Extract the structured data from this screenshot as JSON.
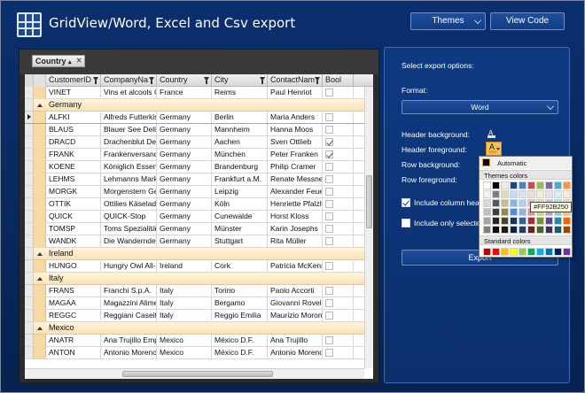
{
  "app": {
    "title": "GridView/Word, Excel and Csv export",
    "themes_label": "Themes",
    "view_code_label": "View Code"
  },
  "grid": {
    "group_chip": "Country",
    "columns": [
      "CustomerID",
      "CompanyNa",
      "Country",
      "City",
      "ContactNam",
      "Bool"
    ],
    "rows": [
      {
        "type": "data",
        "cells": [
          "VINET",
          "Vins et alcools C",
          "France",
          "Reims",
          "Paul Henriot",
          ""
        ],
        "bool": false
      },
      {
        "type": "group",
        "label": "Germany"
      },
      {
        "type": "data",
        "cells": [
          "ALFKI",
          "Alfreds Futterkis",
          "Germany",
          "Berlin",
          "Maria Anders",
          ""
        ],
        "bool": false,
        "selected": true
      },
      {
        "type": "data",
        "cells": [
          "BLAUS",
          "Blauer See Delik",
          "Germany",
          "Mannheim",
          "Hanna Moos",
          ""
        ],
        "bool": false
      },
      {
        "type": "data",
        "cells": [
          "DRACD",
          "Drachenblut Del",
          "Germany",
          "Aachen",
          "Sven Ottlieb",
          ""
        ],
        "bool": true
      },
      {
        "type": "data",
        "cells": [
          "FRANK",
          "Frankenversand",
          "Germany",
          "München",
          "Peter Franken",
          ""
        ],
        "bool": true
      },
      {
        "type": "data",
        "cells": [
          "KOENE",
          "Königlich Essen",
          "Germany",
          "Brandenburg",
          "Philip Cramer",
          ""
        ],
        "bool": false
      },
      {
        "type": "data",
        "cells": [
          "LEHMS",
          "Lehmanns Markt",
          "Germany",
          "Frankfurt a.M.",
          "Renate Messner",
          ""
        ],
        "bool": false
      },
      {
        "type": "data",
        "cells": [
          "MORGK",
          "Morgenstern Ges",
          "Germany",
          "Leipzig",
          "Alexander Feue",
          ""
        ],
        "bool": false
      },
      {
        "type": "data",
        "cells": [
          "OTTIK",
          "Ottilies Käselade",
          "Germany",
          "Köln",
          "Henriette Pfalzh",
          ""
        ],
        "bool": false
      },
      {
        "type": "data",
        "cells": [
          "QUICK",
          "QUICK-Stop",
          "Germany",
          "Cunewalde",
          "Horst Kloss",
          ""
        ],
        "bool": false
      },
      {
        "type": "data",
        "cells": [
          "TOMSP",
          "Toms Spezialität",
          "Germany",
          "Münster",
          "Karin Josephs",
          ""
        ],
        "bool": false
      },
      {
        "type": "data",
        "cells": [
          "WANDK",
          "Die Wandernde",
          "Germany",
          "Stuttgart",
          "Rita Müller",
          ""
        ],
        "bool": false
      },
      {
        "type": "group",
        "label": "Ireland"
      },
      {
        "type": "data",
        "cells": [
          "HUNGO",
          "Hungry Owl All-I",
          "Ireland",
          "Cork",
          "Patricia McKenn",
          ""
        ],
        "bool": false
      },
      {
        "type": "group",
        "label": "Italy"
      },
      {
        "type": "data",
        "cells": [
          "FRANS",
          "Franchi S.p.A.",
          "Italy",
          "Torino",
          "Paolo Accorti",
          ""
        ],
        "bool": false
      },
      {
        "type": "data",
        "cells": [
          "MAGAA",
          "Magazzini Alime",
          "Italy",
          "Bergamo",
          "Giovanni Rovelli",
          ""
        ],
        "bool": false
      },
      {
        "type": "data",
        "cells": [
          "REGGC",
          "Reggiani Caseifi",
          "Italy",
          "Reggio Emilia",
          "Maurizio Moroni",
          ""
        ],
        "bool": false
      },
      {
        "type": "group",
        "label": "Mexico"
      },
      {
        "type": "data",
        "cells": [
          "ANATR",
          "Ana Trujillo Emp",
          "Mexico",
          "México D.F.",
          "Ana Trujillo",
          ""
        ],
        "bool": false
      },
      {
        "type": "data",
        "cells": [
          "ANTON",
          "Antonio Moreno",
          "Mexico",
          "México D.F.",
          "Antonio Moreno",
          ""
        ],
        "bool": false
      }
    ]
  },
  "export": {
    "select_options": "Select export options:",
    "format_label": "Format:",
    "format_value": "Word",
    "header_background": "Header background:",
    "header_foreground": "Header foreground:",
    "row_background": "Row background:",
    "row_foreground": "Row foreground:",
    "include_headers": "Include column heade",
    "include_selected": "Include only selected",
    "export_button": "Export",
    "picker_letter": "A"
  },
  "color_popup": {
    "automatic": "Automatic",
    "themes_colors": "Themes colors",
    "standard_colors": "Standard colors",
    "tooltip": "#FF92B250",
    "theme_swatches": [
      "#ffffff",
      "#000000",
      "#eeece1",
      "#1f497d",
      "#4f81bd",
      "#c0504d",
      "#9bbb59",
      "#8064a2",
      "#4bacc6",
      "#f79646",
      "#f2f2f2",
      "#7f7f7f",
      "#ddd9c3",
      "#c6d9f0",
      "#dbe5f1",
      "#f2dcdb",
      "#ebf1dd",
      "#e5e0ec",
      "#dbeef3",
      "#fdeada",
      "#d8d8d8",
      "#595959",
      "#c4bd97",
      "#8db3e2",
      "#b8cce4",
      "#e5b9b7",
      "#d7e3bc",
      "#ccc1d9",
      "#b7dde8",
      "#fbd5b5",
      "#bfbfbf",
      "#3f3f3f",
      "#938953",
      "#548dd4",
      "#95b3d7",
      "#d99694",
      "#c3d69b",
      "#b2a2c7",
      "#92cddc",
      "#fac08f",
      "#a5a5a5",
      "#262626",
      "#494429",
      "#17365d",
      "#366092",
      "#953734",
      "#76923c",
      "#5f497a",
      "#31859b",
      "#e36c09",
      "#7f7f7f",
      "#0c0c0c",
      "#1d1b10",
      "#0f243e",
      "#244061",
      "#632423",
      "#4f6128",
      "#3f3151",
      "#205867",
      "#974806"
    ],
    "standard_swatches": [
      "#c00000",
      "#ff0000",
      "#ffc000",
      "#ffff00",
      "#92d050",
      "#00b050",
      "#00b0f0",
      "#0070c0",
      "#002060",
      "#7030a0"
    ]
  }
}
